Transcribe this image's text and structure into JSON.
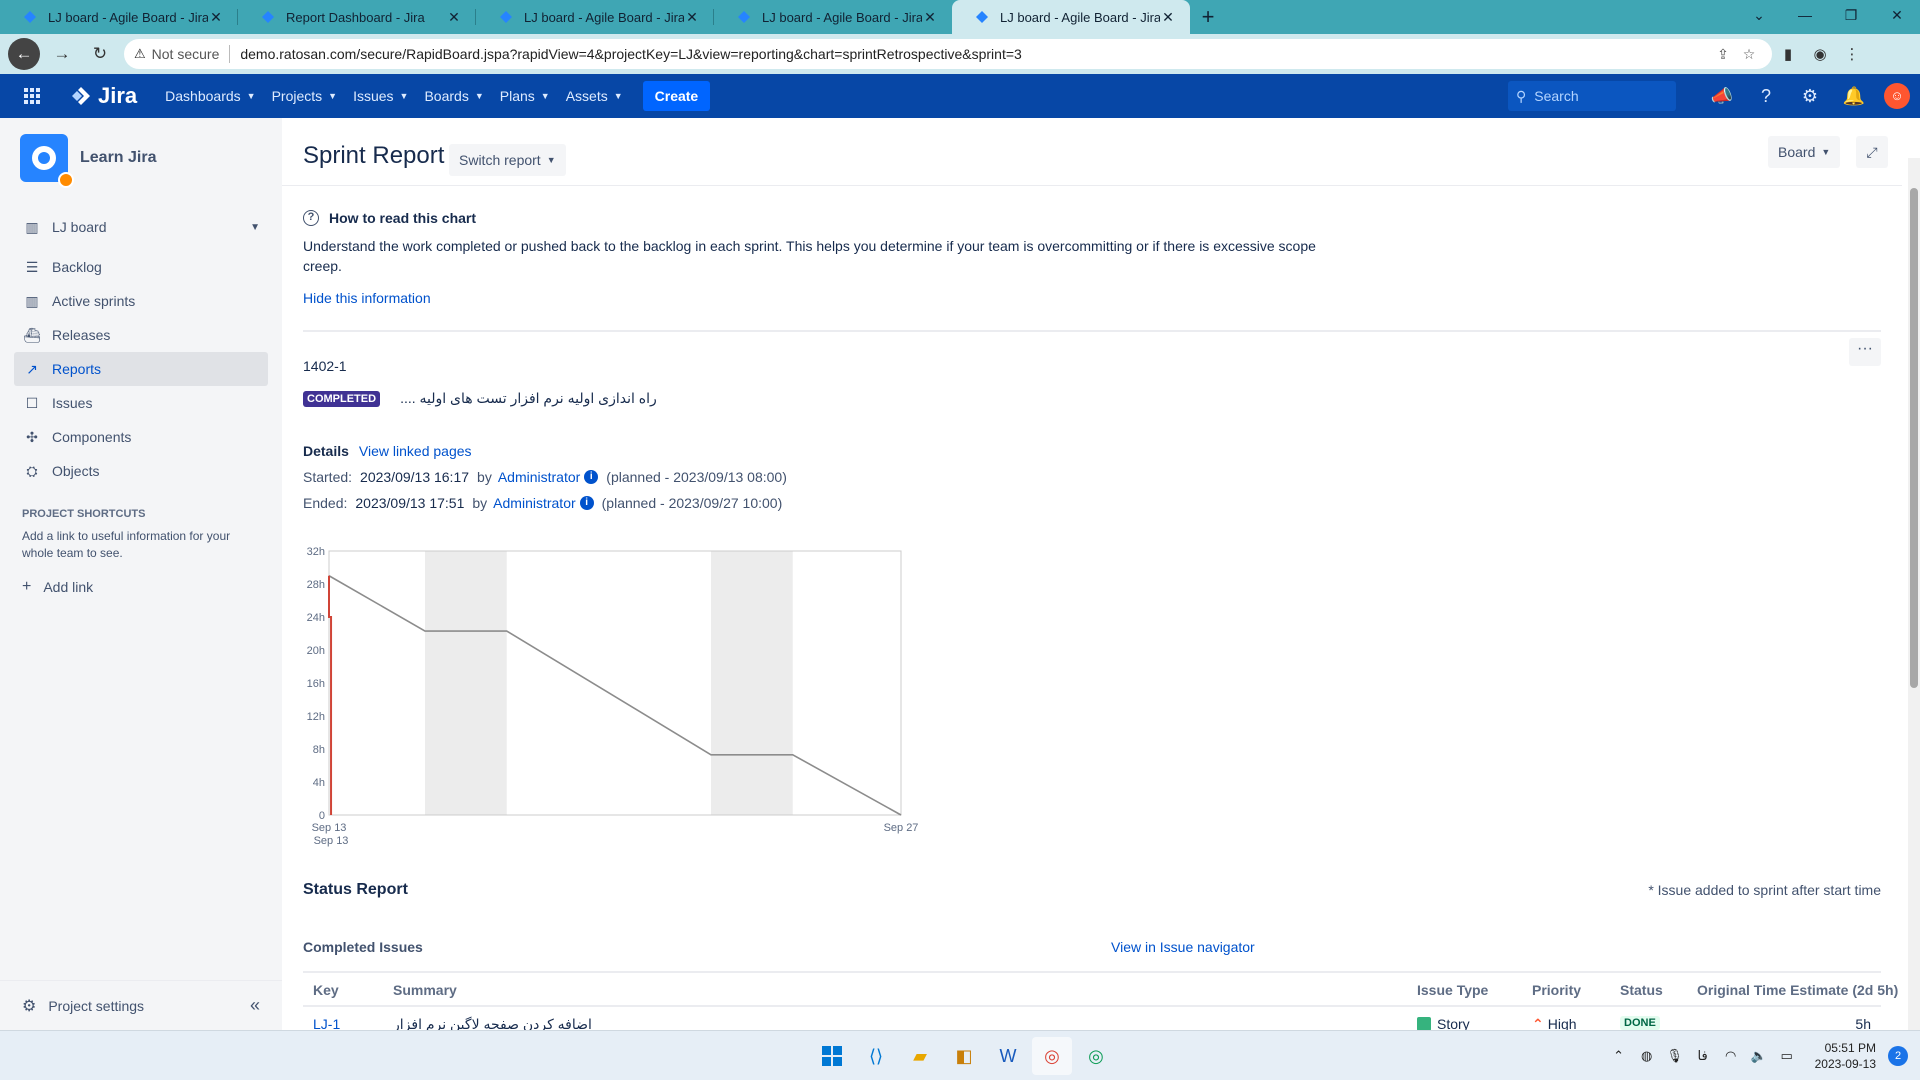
{
  "browser": {
    "tabs": [
      {
        "title": "LJ board - Agile Board - Jira",
        "active": false
      },
      {
        "title": "Report Dashboard - Jira",
        "active": false
      },
      {
        "title": "LJ board - Agile Board - Jira",
        "active": false
      },
      {
        "title": "LJ board - Agile Board - Jira",
        "active": false
      },
      {
        "title": "LJ board - Agile Board - Jira",
        "active": true
      }
    ],
    "security_label": "Not secure",
    "url": "demo.ratosan.com/secure/RapidBoard.jspa?rapidView=4&projectKey=LJ&view=reporting&chart=sprintRetrospective&sprint=3"
  },
  "jira_nav": {
    "logo": "Jira",
    "items": [
      "Dashboards",
      "Projects",
      "Issues",
      "Boards",
      "Plans",
      "Assets"
    ],
    "create_label": "Create",
    "search_placeholder": "Search"
  },
  "sidebar": {
    "project_name": "Learn Jira",
    "board_label": "LJ board",
    "items": [
      {
        "label": "Backlog",
        "icon": "backlog-icon",
        "active": false
      },
      {
        "label": "Active sprints",
        "icon": "board-icon",
        "active": false
      },
      {
        "label": "Releases",
        "icon": "ship-icon",
        "active": false
      },
      {
        "label": "Reports",
        "icon": "chart-icon",
        "active": true
      },
      {
        "label": "Issues",
        "icon": "issues-icon",
        "active": false
      },
      {
        "label": "Components",
        "icon": "puzzle-icon",
        "active": false
      },
      {
        "label": "Objects",
        "icon": "objects-icon",
        "active": false
      }
    ],
    "shortcuts_heading": "PROJECT SHORTCUTS",
    "shortcuts_desc": "Add a link to useful information for your whole team to see.",
    "add_link": "Add link",
    "settings": "Project settings"
  },
  "page": {
    "title": "Sprint Report",
    "switch_report": "Switch report",
    "board_button": "Board",
    "howto_title": "How to read this chart",
    "howto_desc": "Understand the work completed or pushed back to the backlog in each sprint. This helps you determine if your team is overcommitting or if there is excessive scope creep.",
    "hide_info": "Hide this information",
    "sprint_name": "1402-1",
    "status_lozenge": "COMPLETED",
    "sprint_goal": "راه اندازی اولیه نرم افزار تست های اولیه ....",
    "details_label": "Details",
    "view_linked": "View linked pages",
    "started_label": "Started:",
    "started_value": "2023/09/13 16:17",
    "ended_label": "Ended:",
    "ended_value": "2023/09/13 17:51",
    "by": "by",
    "admin": "Administrator",
    "started_planned": "(planned - 2023/09/13 08:00)",
    "ended_planned": "(planned - 2023/09/27 10:00)"
  },
  "chart_data": {
    "type": "line",
    "title": "",
    "xlabel": "",
    "ylabel": "",
    "y_ticks": [
      "0",
      "4h",
      "8h",
      "12h",
      "16h",
      "20h",
      "24h",
      "28h",
      "32h"
    ],
    "ylim": [
      0,
      32
    ],
    "x_ticks": [
      "Sep 13",
      "Sep 27"
    ],
    "x_sublabel": "Sep 13",
    "xlim_days": [
      0,
      14
    ],
    "non_working_bands_days": [
      [
        2.35,
        4.35
      ],
      [
        9.35,
        11.35
      ]
    ],
    "guideline": {
      "x": [
        0,
        2.35,
        4.35,
        9.35,
        11.35,
        14
      ],
      "y": [
        29,
        22.3,
        22.3,
        7.3,
        7.3,
        0
      ]
    },
    "remaining_values": {
      "x": [
        0,
        0,
        0.05,
        0.05
      ],
      "y": [
        29,
        24,
        24,
        0
      ]
    },
    "series_colors": {
      "guideline": "#8c8c8c",
      "remaining": "#d04437"
    }
  },
  "status_report": {
    "heading": "Status Report",
    "note": "* Issue added to sprint after start time",
    "completed_heading": "Completed Issues",
    "view_navigator": "View in Issue navigator",
    "columns": [
      "Key",
      "Summary",
      "Issue Type",
      "Priority",
      "Status",
      "Original Time Estimate (2d 5h)"
    ],
    "rows": [
      {
        "key": "LJ-1",
        "summary": "اضافه کردن صفحه لاگین نرم افزار",
        "type": "Story",
        "priority": "High",
        "status": "DONE",
        "estimate": "5h"
      }
    ]
  },
  "taskbar": {
    "time": "05:51 PM",
    "date": "2023-09-13",
    "lang": "فا",
    "notifications": "2"
  }
}
